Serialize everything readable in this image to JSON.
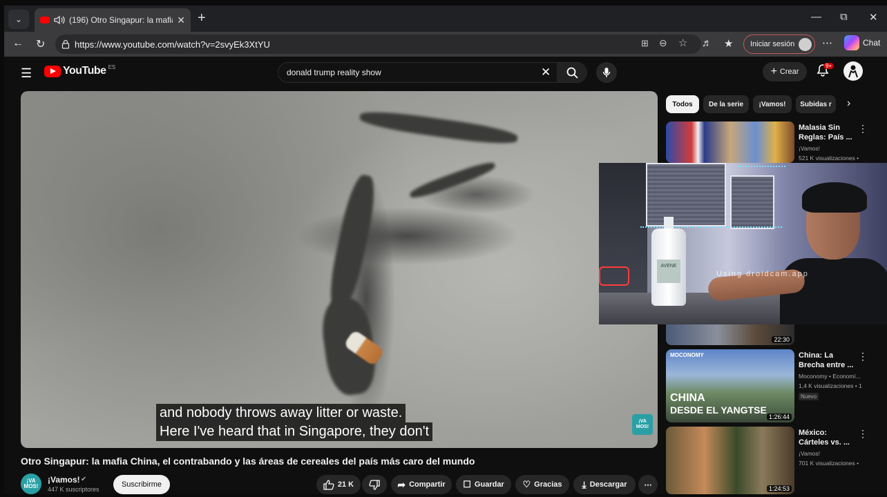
{
  "browser": {
    "tab_title": "(196) Otro Singapur: la mafia",
    "url": "https://www.youtube.com/watch?v=2svyEk3XtYU",
    "signin_label": "Iniciar sesión",
    "chat_label": "Chat"
  },
  "youtube": {
    "logo_text": "YouTube",
    "region": "ES",
    "search_query": "donald trump reality show",
    "create_label": "Crear",
    "notification_count": "9+",
    "chips": [
      "Todos",
      "De la serie",
      "¡Vamos!",
      "Subidas r"
    ]
  },
  "video": {
    "subtitle_line1": "and nobody throws away litter or waste.",
    "subtitle_line2": "Here I've heard that in Singapore, they don't",
    "watermark": "¡VA MOS!",
    "title": "Otro Singapur: la mafia China, el contrabando y las áreas de cereales del país más caro del mundo",
    "channel_avatar": "¡VA MOS!",
    "channel": "¡Vamos!",
    "subscribers": "447 K suscriptores",
    "subscribe_label": "Suscribirme",
    "likes": "21 K",
    "share_label": "Compartir",
    "save_label": "Guardar",
    "thanks_label": "Gracias",
    "download_label": "Descargar"
  },
  "recommendations": [
    {
      "title": "Malasia Sin Reglas: País ...",
      "channel": "¡Vamos!",
      "meta": "521 K visualizaciones •",
      "duration": ""
    },
    {
      "title": "",
      "channel": "",
      "meta": "",
      "duration": "22:30"
    },
    {
      "title": "China: La Brecha entre ...",
      "channel": "Moconomy • Economí...",
      "meta": "1,4 K visualizaciones • 1",
      "badge": "Nuevo",
      "thumb_brand": "MOCONOMY",
      "thumb_text1": "CHINA",
      "thumb_text2": "DESDE EL YANGTSE",
      "duration": "1:26:44"
    },
    {
      "title": "México: Cárteles vs. ...",
      "channel": "¡Vamos!",
      "meta": "701 K visualizaciones •",
      "duration": "1:24:53"
    }
  ],
  "webcam": {
    "watermark": "Using droidcam.app",
    "bottle_label": "AVENE"
  },
  "colors": {
    "youtube_red": "#ff0000",
    "page_bg": "#0f0f0f",
    "chip_bg": "#272727",
    "channel_teal": "#2aa0a5"
  }
}
